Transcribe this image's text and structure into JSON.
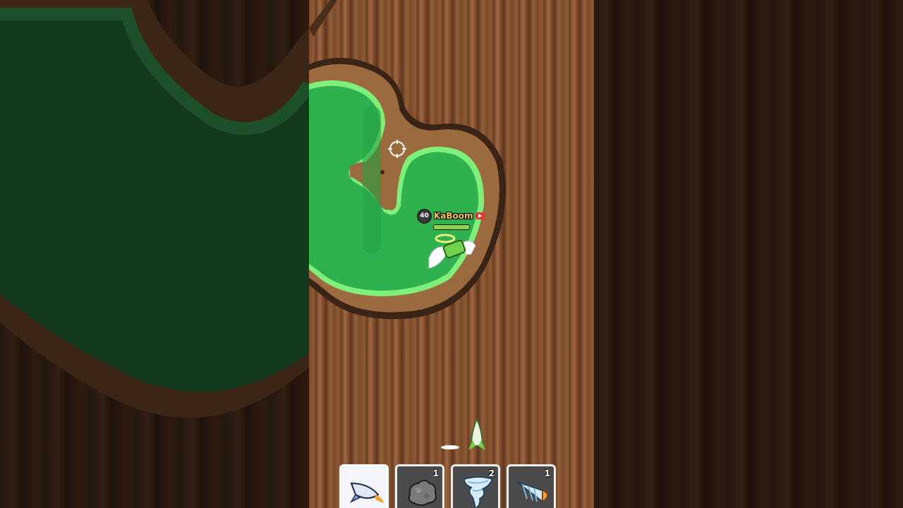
{
  "player": {
    "name": "KaBoom",
    "level": "40",
    "health": 1.0
  },
  "hotbar": {
    "slots": [
      {
        "item": "rocket-icon",
        "count": "",
        "selected": true
      },
      {
        "item": "rock-icon",
        "count": "1",
        "selected": false
      },
      {
        "item": "tornado-icon",
        "count": "2",
        "selected": false
      },
      {
        "item": "drill-icon",
        "count": "1",
        "selected": false
      }
    ]
  },
  "colors": {
    "grass": "#2fb14f",
    "grass_border": "#7ef07a",
    "dirt_rim": "#8a5a34",
    "bark": "#7a4a2b",
    "name_text": "#f7c948"
  }
}
